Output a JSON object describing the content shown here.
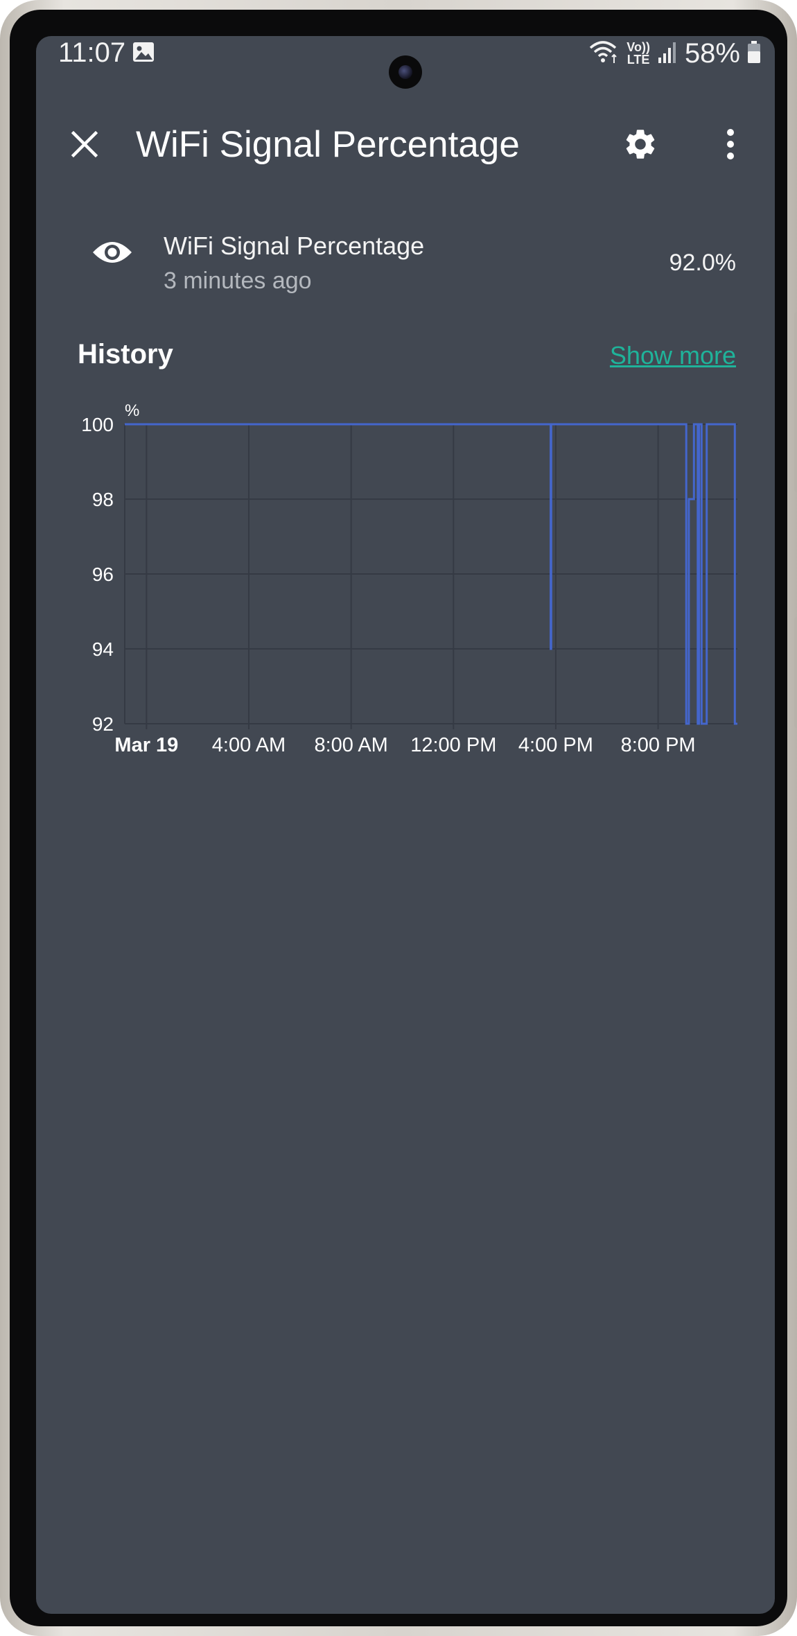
{
  "status_bar": {
    "time": "11:07",
    "signal_lte": "LTE",
    "volte": "Vo))",
    "battery": "58%",
    "icons": [
      "gallery-icon",
      "wifi-icon",
      "volte-lte-icon",
      "cell-signal-icon",
      "battery-icon"
    ]
  },
  "app_bar": {
    "title": "WiFi Signal Percentage",
    "close_icon": "close-icon",
    "settings_icon": "gear-icon",
    "menu_icon": "more-vert-icon"
  },
  "entity": {
    "icon": "eye-icon",
    "name": "WiFi Signal Percentage",
    "last_changed": "3 minutes ago",
    "state": "92.0%"
  },
  "history": {
    "title": "History",
    "show_more": "Show more"
  },
  "colors": {
    "background": "#424852",
    "line": "#4466cc",
    "grid": "#353a44",
    "link": "#1fb39a"
  },
  "chart_data": {
    "type": "line",
    "step": true,
    "ylabel": "%",
    "ylim": [
      92,
      100
    ],
    "y_ticks": [
      100,
      98,
      96,
      94,
      92
    ],
    "x_ticks": [
      "Mar 19",
      "4:00 AM",
      "8:00 AM",
      "12:00 PM",
      "4:00 PM",
      "8:00 PM"
    ],
    "x_tick_hours": [
      0,
      4,
      8,
      12,
      16,
      20
    ],
    "xlim_hours": [
      -0.85,
      23.1
    ],
    "grid": true,
    "legend": "none",
    "series": [
      {
        "points": [
          [
            -0.85,
            100
          ],
          [
            15.8,
            100
          ],
          [
            15.8,
            94
          ],
          [
            15.82,
            94
          ],
          [
            15.82,
            100
          ],
          [
            21.1,
            100
          ],
          [
            21.1,
            92
          ],
          [
            21.2,
            92
          ],
          [
            21.2,
            98
          ],
          [
            21.4,
            98
          ],
          [
            21.4,
            100
          ],
          [
            21.55,
            100
          ],
          [
            21.55,
            92
          ],
          [
            21.6,
            92
          ],
          [
            21.6,
            100
          ],
          [
            21.7,
            100
          ],
          [
            21.7,
            92
          ],
          [
            21.9,
            92
          ],
          [
            21.9,
            100
          ],
          [
            23.0,
            100
          ],
          [
            23.0,
            92
          ],
          [
            23.1,
            92
          ]
        ]
      }
    ]
  }
}
